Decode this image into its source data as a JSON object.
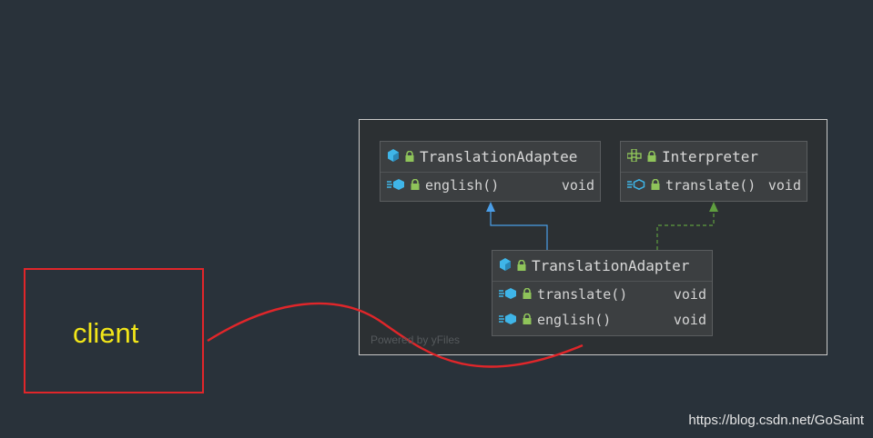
{
  "client": {
    "label": "client"
  },
  "diagram": {
    "watermark": "Powered by yFiles",
    "classes": [
      {
        "name": "TranslationAdaptee",
        "kind": "class",
        "methods": [
          {
            "name": "english()",
            "type": "void"
          }
        ]
      },
      {
        "name": "Interpreter",
        "kind": "interface",
        "methods": [
          {
            "name": "translate()",
            "type": "void"
          }
        ]
      },
      {
        "name": "TranslationAdapter",
        "kind": "class",
        "methods": [
          {
            "name": "translate()",
            "type": "void"
          },
          {
            "name": "english()",
            "type": "void"
          }
        ]
      }
    ],
    "relations": [
      {
        "from": "TranslationAdapter",
        "to": "TranslationAdaptee",
        "type": "extends"
      },
      {
        "from": "TranslationAdapter",
        "to": "Interpreter",
        "type": "implements"
      }
    ]
  },
  "credit": "https://blog.csdn.net/GoSaint",
  "colors": {
    "background": "#29323a",
    "annotation_red": "#e0262a",
    "client_text": "#f2e619",
    "extends_arrow": "#4a9ee8",
    "implements_arrow": "#5f9e3f",
    "class_icon": "#3fb5e8",
    "lock_icon": "#8fc45a"
  }
}
